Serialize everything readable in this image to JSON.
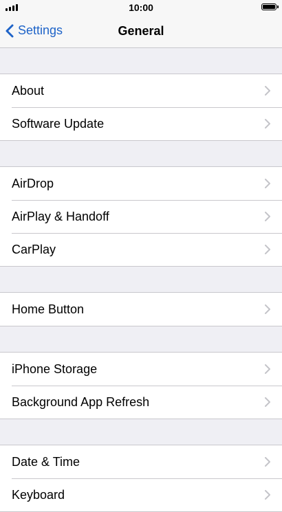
{
  "status_bar": {
    "time": "10:00"
  },
  "nav": {
    "back_label": "Settings",
    "title": "General"
  },
  "groups": [
    {
      "items": [
        {
          "label": "About"
        },
        {
          "label": "Software Update"
        }
      ]
    },
    {
      "items": [
        {
          "label": "AirDrop"
        },
        {
          "label": "AirPlay & Handoff"
        },
        {
          "label": "CarPlay"
        }
      ]
    },
    {
      "items": [
        {
          "label": "Home Button"
        }
      ]
    },
    {
      "items": [
        {
          "label": "iPhone Storage"
        },
        {
          "label": "Background App Refresh"
        }
      ]
    },
    {
      "items": [
        {
          "label": "Date & Time"
        },
        {
          "label": "Keyboard"
        }
      ]
    }
  ],
  "icons": {
    "back": "chevron-left-icon",
    "row": "chevron-right-icon"
  },
  "colors": {
    "accent": "#1e63c8",
    "background": "#efeff4",
    "separator": "#c8c7cc"
  }
}
